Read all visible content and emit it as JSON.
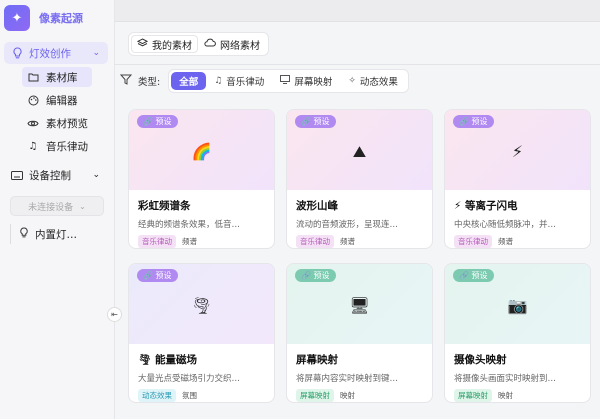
{
  "app": {
    "name": "像素起源"
  },
  "sidebar": {
    "group_light": "灯效创作",
    "items": [
      {
        "label": "素材库",
        "icon": "folder-icon"
      },
      {
        "label": "编辑器",
        "icon": "palette-icon"
      },
      {
        "label": "素材预览",
        "icon": "eye-icon"
      },
      {
        "label": "音乐律动",
        "icon": "music-note-icon"
      }
    ],
    "group_device": "设备控制",
    "device_select": "未连接设备",
    "device_item": "内置灯…"
  },
  "main": {
    "tabs": [
      {
        "label": "我的素材",
        "icon": "layers-icon"
      },
      {
        "label": "网络素材",
        "icon": "cloud-icon"
      }
    ],
    "filter": {
      "label": "类型:",
      "chips": [
        {
          "label": "全部"
        },
        {
          "label": "音乐律动"
        },
        {
          "label": "屏幕映射"
        },
        {
          "label": "动态效果"
        }
      ]
    },
    "cards": [
      {
        "badge": "预设",
        "emoji": "🌈",
        "title": "彩虹频谱条",
        "desc": "经典的频谱条效果，低音…",
        "tag": "音乐律动",
        "subtag": "频谱"
      },
      {
        "badge": "预设",
        "emoji": "⛰",
        "title": "波形山峰",
        "desc": "流动的音频波形，呈现连…",
        "tag": "音乐律动",
        "subtag": "频谱"
      },
      {
        "badge": "预设",
        "emoji": "⚡",
        "title": "⚡ 等离子闪电",
        "desc": "中央核心随低频脉冲，并…",
        "tag": "音乐律动",
        "subtag": "频谱"
      },
      {
        "badge": "预设",
        "emoji": "🌪",
        "title": "🌪 能量磁场",
        "desc": "大量光点受磁场引力交织…",
        "tag": "动态效果",
        "subtag": "氛围"
      },
      {
        "badge": "预设",
        "emoji": "🖥",
        "title": "屏幕映射",
        "desc": "将屏幕内容实时映射到键…",
        "tag": "屏幕映射",
        "subtag": "映射"
      },
      {
        "badge": "预设",
        "emoji": "📷",
        "title": "摄像头映射",
        "desc": "将摄像头画面实时映射到…",
        "tag": "屏幕映射",
        "subtag": "映射"
      }
    ]
  }
}
